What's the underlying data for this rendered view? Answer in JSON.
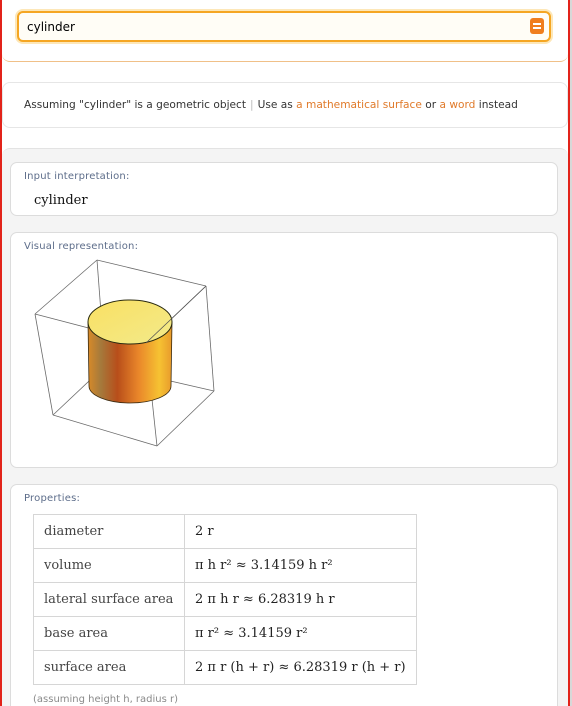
{
  "search": {
    "query": "cylinder"
  },
  "assumption": {
    "prefix": "Assuming \"cylinder\" is a geometric object",
    "separator": "|",
    "use_as": "Use as",
    "option1": "a mathematical surface",
    "or": "or",
    "option2": "a word",
    "instead": "instead"
  },
  "pods": {
    "input": {
      "title": "Input interpretation:",
      "value": "cylinder"
    },
    "visual": {
      "title": "Visual representation:"
    },
    "properties": {
      "title": "Properties:",
      "rows": [
        {
          "label": "diameter",
          "value": "2 r"
        },
        {
          "label": "volume",
          "value": "π h r² ≈ 3.14159 h r²"
        },
        {
          "label": "lateral surface area",
          "value": "2 π h r ≈ 6.28319 h r"
        },
        {
          "label": "base area",
          "value": "π r² ≈ 3.14159 r²"
        },
        {
          "label": "surface area",
          "value": "2 π r (h + r) ≈ 6.28319 r (h + r)"
        }
      ],
      "note": "(assuming height h, radius r)"
    }
  },
  "colors": {
    "frame": "#e2231a",
    "accent": "#f5a623",
    "link": "#e07a2a",
    "cylinder_top": "#f7e95a",
    "cylinder_side_dark": "#b8521a",
    "cylinder_side_light": "#f3b42c"
  }
}
